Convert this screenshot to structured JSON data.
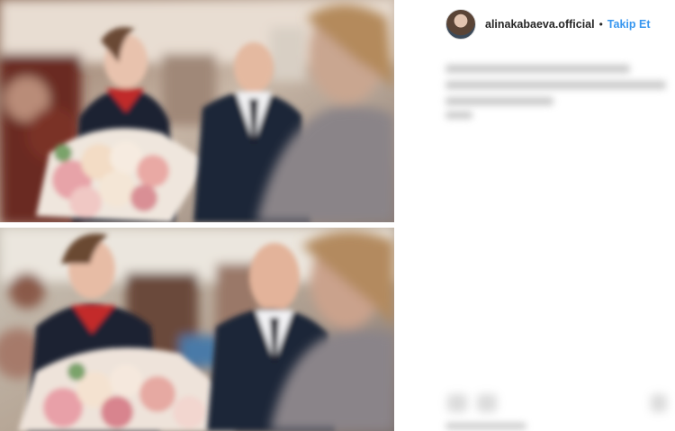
{
  "post": {
    "username": "alinakabaeva.official",
    "separator": "•",
    "follow_label": "Takip Et"
  },
  "colors": {
    "accent": "#3897f0",
    "text": "#262626",
    "background": "#ffffff"
  },
  "icons": {
    "avatar": "profile-avatar"
  }
}
